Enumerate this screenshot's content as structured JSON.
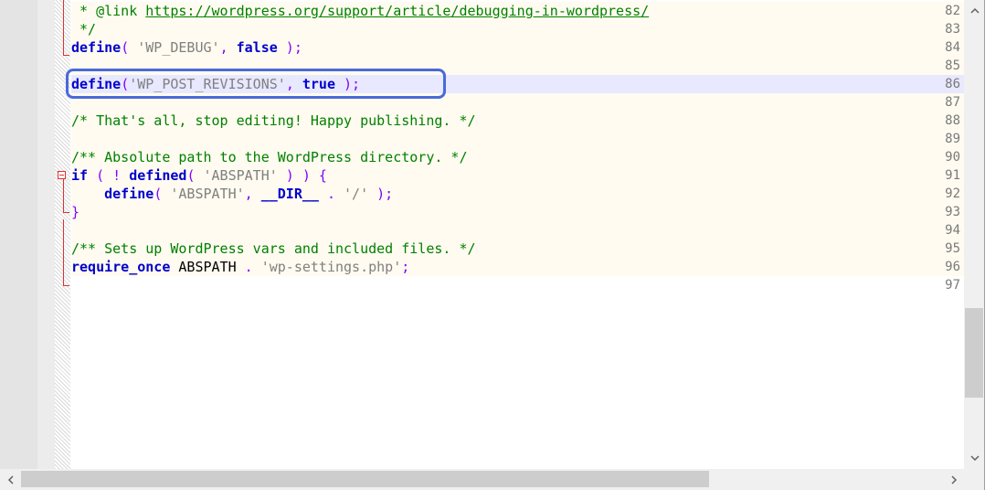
{
  "editor": {
    "lines": [
      {
        "num": "82",
        "tokens": [
          {
            "c": "cm",
            "t": " * @link "
          },
          {
            "c": "lnk",
            "t": "https://wordpress.org/support/article/debugging-in-wordpress/"
          }
        ]
      },
      {
        "num": "83",
        "tokens": [
          {
            "c": "cm",
            "t": " */"
          }
        ]
      },
      {
        "num": "84",
        "tokens": [
          {
            "c": "kw",
            "t": "define"
          },
          {
            "c": "op",
            "t": "( "
          },
          {
            "c": "st",
            "t": "'WP_DEBUG'"
          },
          {
            "c": "op",
            "t": ", "
          },
          {
            "c": "kw",
            "t": "false"
          },
          {
            "c": "op",
            "t": " );"
          }
        ]
      },
      {
        "num": "85",
        "tokens": []
      },
      {
        "num": "86",
        "active": true,
        "tokens": [
          {
            "c": "kw",
            "t": "define"
          },
          {
            "c": "op",
            "t": "("
          },
          {
            "c": "st",
            "t": "'WP_POST_REVISIONS'"
          },
          {
            "c": "op",
            "t": ", "
          },
          {
            "c": "kw",
            "t": "true"
          },
          {
            "c": "op",
            "t": " );"
          }
        ]
      },
      {
        "num": "87",
        "tokens": []
      },
      {
        "num": "88",
        "tokens": [
          {
            "c": "cm",
            "t": "/* That's all, stop editing! Happy publishing. */"
          }
        ]
      },
      {
        "num": "89",
        "tokens": []
      },
      {
        "num": "90",
        "tokens": [
          {
            "c": "cm",
            "t": "/** Absolute path to the WordPress directory. */"
          }
        ]
      },
      {
        "num": "91",
        "tokens": [
          {
            "c": "kw",
            "t": "if"
          },
          {
            "c": "op",
            "t": " ( ! "
          },
          {
            "c": "kw",
            "t": "defined"
          },
          {
            "c": "op",
            "t": "( "
          },
          {
            "c": "st",
            "t": "'ABSPATH'"
          },
          {
            "c": "op",
            "t": " ) ) {"
          }
        ]
      },
      {
        "num": "92",
        "tokens": [
          {
            "c": "pl",
            "t": "    "
          },
          {
            "c": "kw",
            "t": "define"
          },
          {
            "c": "op",
            "t": "( "
          },
          {
            "c": "st",
            "t": "'ABSPATH'"
          },
          {
            "c": "op",
            "t": ", "
          },
          {
            "c": "kw",
            "t": "__DIR__"
          },
          {
            "c": "op",
            "t": " . "
          },
          {
            "c": "st",
            "t": "'/'"
          },
          {
            "c": "op",
            "t": " );"
          }
        ]
      },
      {
        "num": "93",
        "tokens": [
          {
            "c": "op",
            "t": "}"
          }
        ]
      },
      {
        "num": "94",
        "tokens": []
      },
      {
        "num": "95",
        "tokens": [
          {
            "c": "cm",
            "t": "/** Sets up WordPress vars and included files. */"
          }
        ]
      },
      {
        "num": "96",
        "tokens": [
          {
            "c": "kw",
            "t": "require_once"
          },
          {
            "c": "pl",
            "t": " ABSPATH "
          },
          {
            "c": "op",
            "t": ". "
          },
          {
            "c": "st",
            "t": "'wp-settings.php'"
          },
          {
            "c": "op",
            "t": ";"
          }
        ]
      },
      {
        "num": "97",
        "blank_area": true,
        "tokens": []
      }
    ]
  },
  "scrollbars": {
    "up_arrow": "chevron-up-icon",
    "down_arrow": "chevron-down-icon",
    "left_arrow": "chevron-left-icon",
    "right_arrow": "chevron-right-icon"
  },
  "colors": {
    "keyword": "#0000cc",
    "string": "#808080",
    "operator": "#8000ff",
    "comment": "#008000",
    "highlight_border": "#4a6ad8",
    "active_line": "#e8e8ff",
    "fold_marker": "#e03030"
  }
}
